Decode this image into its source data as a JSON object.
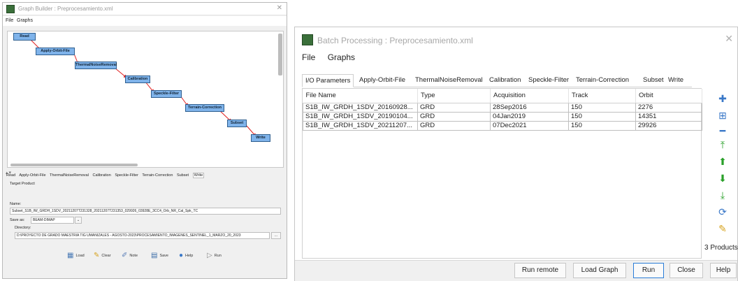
{
  "graph_builder": {
    "title": "Graph Builder : Preprocesamiento.xml",
    "menu": [
      "File",
      "Graphs"
    ],
    "nodes": [
      "Read",
      "Apply-Orbit-File",
      "ThermalNoiseRemoval",
      "Calibration",
      "Speckle-Filter",
      "Terrain-Correction",
      "Subset",
      "Write"
    ],
    "tabs": [
      "Read",
      "Apply-Orbit-File",
      "ThermalNoiseRemoval",
      "Calibration",
      "Speckle-Filter",
      "Terrain-Correction",
      "Subset",
      "Write"
    ],
    "target_product_label": "Target Product",
    "name_label": "Name:",
    "name_value": "Subset_S1B_IW_GRDH_1SDV_20211207T231328_20211207T231353_029926_03928E_3CC4_Orb_NR_Cal_Spk_TC",
    "save_as_label": "Save as:",
    "save_as_value": "BEAM-DIMAP",
    "directory_label": "Directory:",
    "directory_value": "D:\\PROYECTO DE GRADO MAESTRIA TIG UMANIZALES - AGOSTO-2023\\PROCESAMIENTO_IMAGENES_SENTINEL_1_MARZO_20_2023",
    "browse_label": "...",
    "buttons": {
      "load": "Load",
      "clear": "Clear",
      "note": "Note",
      "save": "Save",
      "help": "Help",
      "run": "Run"
    }
  },
  "batch": {
    "title": "Batch Processing : Preprocesamiento.xml",
    "menu": [
      "File",
      "Graphs"
    ],
    "tabs": [
      "I/O Parameters",
      "Apply-Orbit-File",
      "ThermalNoiseRemoval",
      "Calibration",
      "Speckle-Filter",
      "Terrain-Correction",
      "Subset",
      "Write"
    ],
    "columns": [
      "File Name",
      "Type",
      "Acquisition",
      "Track",
      "Orbit"
    ],
    "rows": [
      [
        "S1B_IW_GRDH_1SDV_20160928...",
        "GRD",
        "28Sep2016",
        "150",
        "2276"
      ],
      [
        "S1B_IW_GRDH_1SDV_20190104...",
        "GRD",
        "04Jan2019",
        "150",
        "14351"
      ],
      [
        "S1B_IW_GRDH_1SDV_20211207...",
        "GRD",
        "07Dec2021",
        "150",
        "29926"
      ]
    ],
    "product_count": "3 Products",
    "buttons": {
      "run_remote": "Run remote",
      "load_graph": "Load Graph",
      "run": "Run",
      "close": "Close",
      "help": "Help"
    },
    "accent": "#2a7dd8",
    "side_icon_color": "#2aa02a"
  }
}
